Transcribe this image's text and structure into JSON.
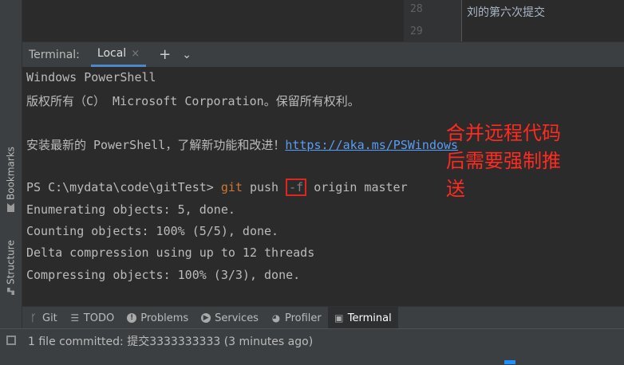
{
  "editor": {
    "line_numbers": [
      "28",
      "29"
    ],
    "line_text": "刘的第六次提交"
  },
  "left_strip": {
    "bookmarks_label": "Bookmarks",
    "structure_label": "Structure"
  },
  "terminal_header": {
    "title": "Terminal:",
    "tab_label": "Local",
    "close_glyph": "×",
    "add_glyph": "+",
    "more_glyph": "⌄"
  },
  "terminal": {
    "line1": "Windows PowerShell",
    "line2": "版权所有（C） Microsoft Corporation。保留所有权利。",
    "line4_prefix": "安装最新的 PowerShell，了解新功能和改进！",
    "line4_link": "https://aka.ms/PSWindows",
    "prompt": "PS C:\\mydata\\code\\gitTest> ",
    "cmd_git": "git",
    "cmd_push": " push ",
    "cmd_flag": "-f",
    "cmd_rest": " origin master",
    "out1": "Enumerating objects: 5, done.",
    "out2": "Counting objects: 100% (5/5), done.",
    "out3": "Delta compression using up to 12 threads",
    "out4": "Compressing objects: 100% (3/3), done."
  },
  "annotation": {
    "text_line1": "合并远程代码",
    "text_line2": "后需要强制推",
    "text_line3": "送",
    "color": "#ff2a20"
  },
  "tool_tabs": [
    {
      "label": "Git",
      "icon": "git-branch-icon"
    },
    {
      "label": "TODO",
      "icon": "list-icon"
    },
    {
      "label": "Problems",
      "icon": "info-icon"
    },
    {
      "label": "Services",
      "icon": "play-icon"
    },
    {
      "label": "Profiler",
      "icon": "profiler-icon"
    },
    {
      "label": "Terminal",
      "icon": "terminal-icon"
    }
  ],
  "status_bar": {
    "message": "1 file committed: 提交3333333333 (3 minutes ago)"
  },
  "colors": {
    "accent": "#4a88c7",
    "link": "#589df6",
    "highlight_box": "#e0251e"
  }
}
